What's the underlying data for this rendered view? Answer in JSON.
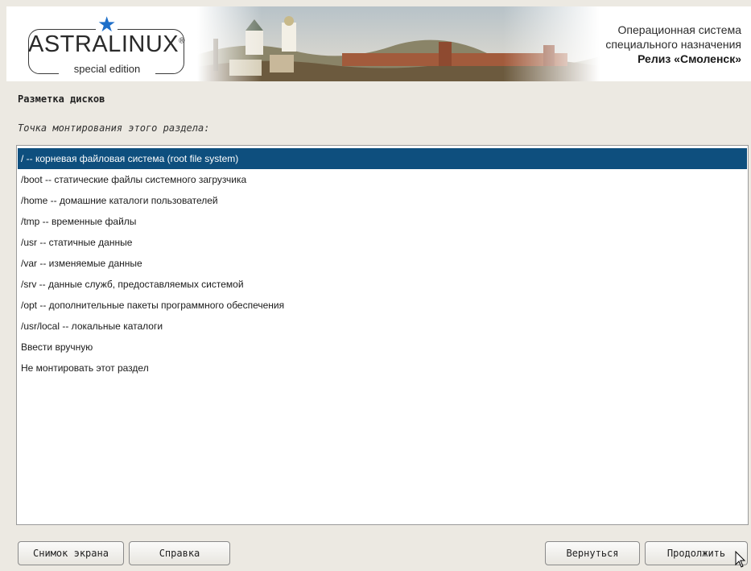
{
  "header": {
    "logo_text": "ASTRALINUX",
    "logo_registered": "®",
    "logo_subtitle": "special edition",
    "release_line1": "Операционная система",
    "release_line2": "специального назначения",
    "release_line3": "Релиз «Смоленск»"
  },
  "section_title": "Разметка дисков",
  "prompt": "Точка монтирования этого раздела:",
  "mount_options": [
    "/ -- корневая файловая система (root file system)",
    "/boot -- статические файлы системного загрузчика",
    "/home -- домашние каталоги пользователей",
    "/tmp -- временные файлы",
    "/usr -- статичные данные",
    "/var -- изменяемые данные",
    "/srv -- данные служб, предоставляемых системой",
    "/opt -- дополнительные пакеты программного обеспечения",
    "/usr/local -- локальные каталоги",
    "Ввести вручную",
    "Не монтировать этот раздел"
  ],
  "selected_index": 0,
  "buttons": {
    "screenshot": "Снимок экрана",
    "help": "Справка",
    "back": "Вернуться",
    "continue": "Продолжить"
  },
  "colors": {
    "selection": "#0e4f7e",
    "logo_star": "#1e6fc9",
    "window_bg": "#ece9e2"
  }
}
